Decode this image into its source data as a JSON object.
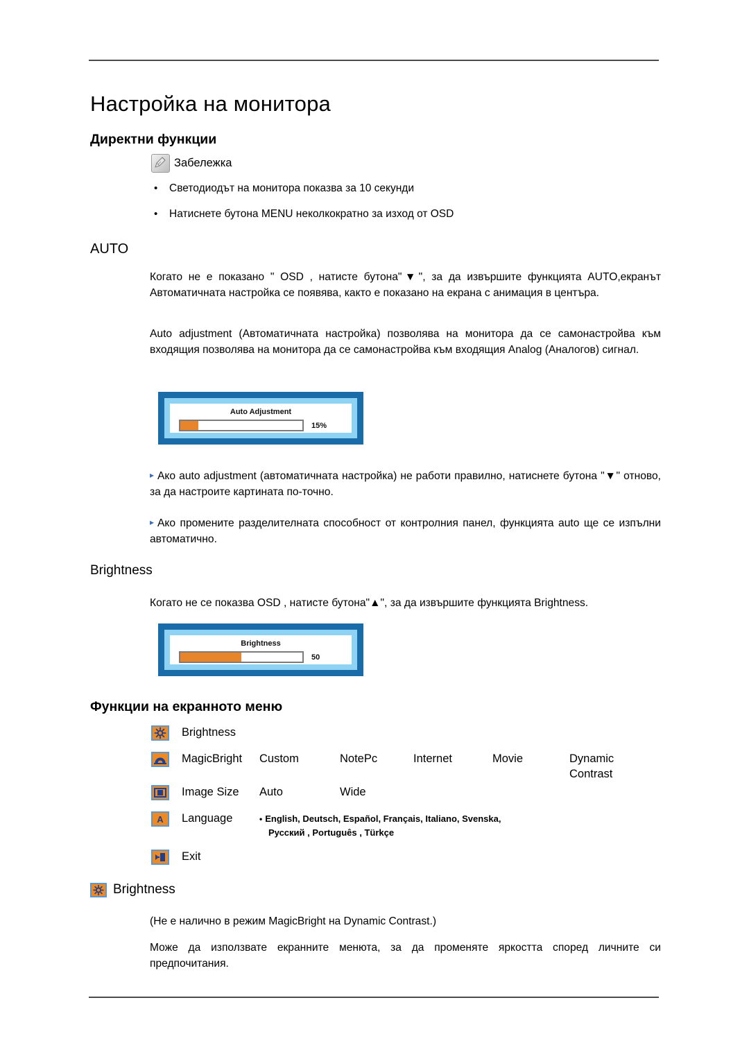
{
  "document": {
    "title": "Настройка на монитора"
  },
  "sections": {
    "direct_functions": {
      "heading": "Директни функции",
      "note": {
        "icon": "note-pen-icon",
        "label": "Забележка",
        "bullets": [
          "Светодиодът на монитора показва за 10 секунди",
          "Натиснете бутона MENU неколкократно за изход от OSD"
        ],
        "bullet_marker": "•"
      }
    },
    "auto": {
      "heading": "AUTO",
      "paragraph_1": "Когато не е показано \" OSD , натисте бутона\"▼\", за да извършите функцията AUTO,екранът Автоматичната настройка се появява, както е показано на екрана с анимация в центъра.",
      "paragraph_2": "Auto adjustment (Автоматичната настройка) позволява на монитора да се самонастройва към входящия позволява на монитора да се самонастройва към входящия Analog (Аналогов) сигнал.",
      "osd": {
        "title": "Auto Adjustment",
        "value_label": "15%",
        "fill_percent": 15,
        "outer_color": "#1a6ca8",
        "inner_color": "#8fd3f4",
        "fill_color": "#e8842a"
      },
      "tips": [
        {
          "marker": "▸",
          "text": "Ако auto adjustment (автоматичната настройка) не работи правилно, натиснете бутона \"▼\" отново, за да настроите картината по-точно."
        },
        {
          "marker": "▸",
          "text": "Ако промените разделителната способност от контролния панел, функцията auto ще се изпълни автоматично."
        }
      ]
    },
    "brightness_direct": {
      "heading": "Brightness",
      "paragraph": "Когато не се показва OSD , натисте бутона\"▲\", за да извършите функцията Brightness.",
      "osd": {
        "title": "Brightness",
        "value_label": "50",
        "fill_percent": 50,
        "outer_color": "#1a6ca8",
        "inner_color": "#8fd3f4",
        "fill_color": "#e8842a"
      }
    },
    "osd_menu": {
      "heading": "Функции на екранното меню",
      "rows": [
        {
          "icon": "brightness-sun-icon",
          "label": "Brightness",
          "options": []
        },
        {
          "icon": "magicbright-arch-icon",
          "label": "MagicBright",
          "options": [
            "Custom",
            "NotePc",
            "Internet",
            "Movie",
            "Dynamic"
          ],
          "option_sub": "Contrast"
        },
        {
          "icon": "image-size-frame-icon",
          "label": "Image Size",
          "options": [
            "Auto",
            "Wide"
          ]
        },
        {
          "icon": "language-a-icon",
          "label": "Language",
          "languages_line_1": "English, Deutsch, Español, Français,  Italiano, Svenska,",
          "languages_line_2": "Русский , Português , Türkçe",
          "languages_bullet": "•"
        },
        {
          "icon": "exit-door-icon",
          "label": "Exit",
          "options": []
        }
      ]
    },
    "brightness_detail": {
      "icon": "brightness-sun-icon",
      "heading": "Brightness",
      "note": "(Не е налично в режим MagicBright на Dynamic Contrast.)",
      "paragraph": "Може да използвате екранните менюта, за да променяте яркостта според личните си предпочитания."
    }
  }
}
